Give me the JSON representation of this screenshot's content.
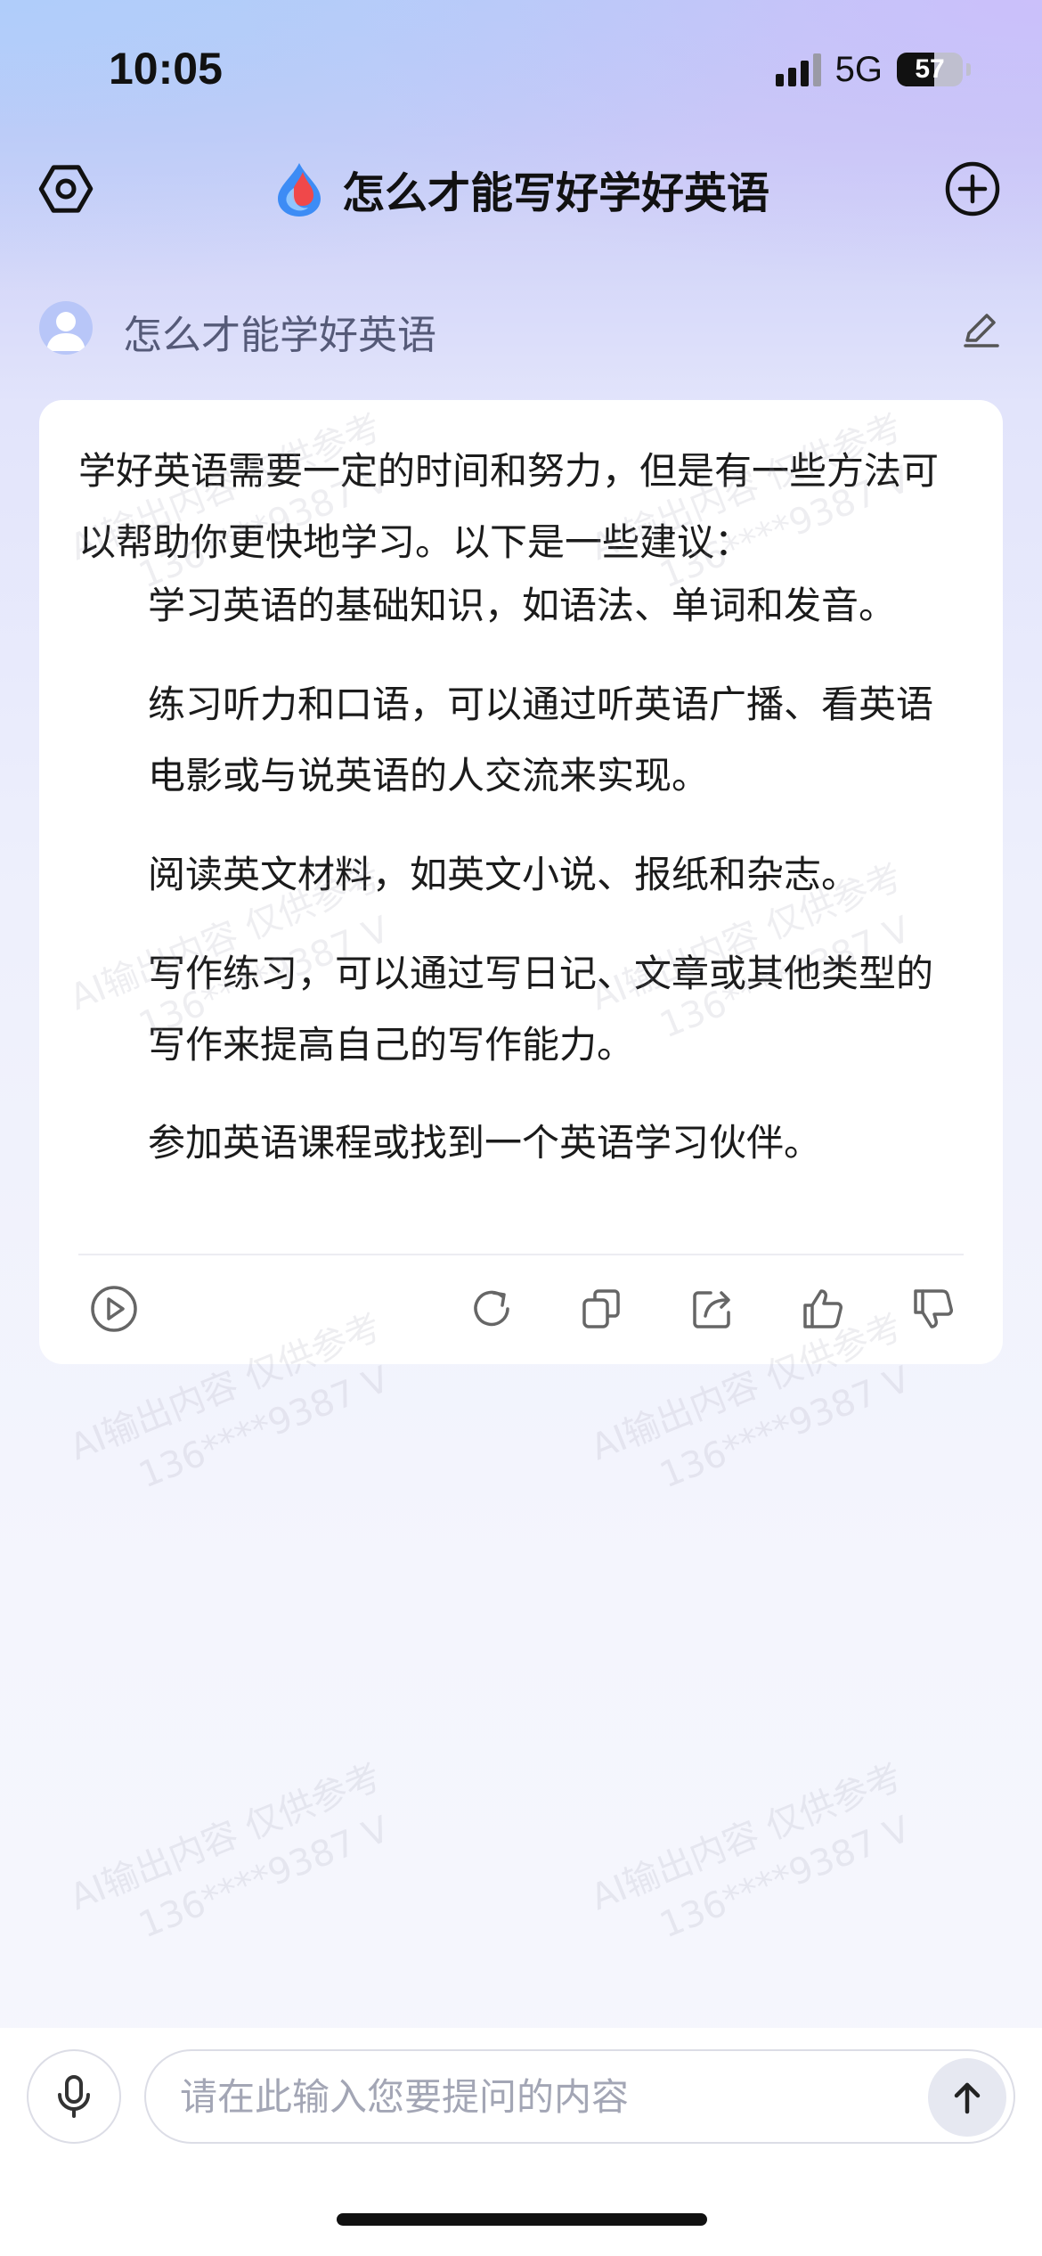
{
  "status_bar": {
    "time": "10:05",
    "network": "5G",
    "battery_level": "57",
    "battery_fraction": 0.57
  },
  "header": {
    "title": "怎么才能写好学好英语",
    "settings_icon": "settings-hexagon-icon",
    "logo_icon": "flame-drop-logo-icon",
    "new_chat_icon": "plus-circle-icon"
  },
  "question": {
    "text": "怎么才能学好英语",
    "avatar_icon": "user-avatar-icon",
    "edit_icon": "pencil-icon"
  },
  "answer": {
    "intro": "学好英语需要一定的时间和努力，但是有一些方法可以帮助你更快地学习。以下是一些建议：",
    "items": [
      "学习英语的基础知识，如语法、单词和发音。",
      "练习听力和口语，可以通过听英语广播、看英语电影或与说英语的人交流来实现。",
      "阅读英文材料，如英文小说、报纸和杂志。",
      "写作练习，可以通过写日记、文章或其他类型的写作来提高自己的写作能力。",
      "参加英语课程或找到一个英语学习伙伴。"
    ],
    "actions": {
      "play_icon": "play-circle-icon",
      "regenerate_icon": "refresh-icon",
      "copy_icon": "copy-icon",
      "share_icon": "share-icon",
      "like_icon": "thumbs-up-icon",
      "dislike_icon": "thumbs-down-icon"
    }
  },
  "watermark": {
    "line1": "AI输出内容 仅供参考",
    "line2": "136****9387 V"
  },
  "input_bar": {
    "placeholder": "请在此输入您要提问的内容",
    "value": "",
    "mic_icon": "microphone-icon",
    "send_icon": "arrow-up-icon"
  },
  "colors": {
    "accent_blue": "#3d7df5",
    "accent_red": "#f0484a",
    "text_primary": "#1b1b1b",
    "text_secondary": "#555a78",
    "card_bg": "#ffffff"
  }
}
